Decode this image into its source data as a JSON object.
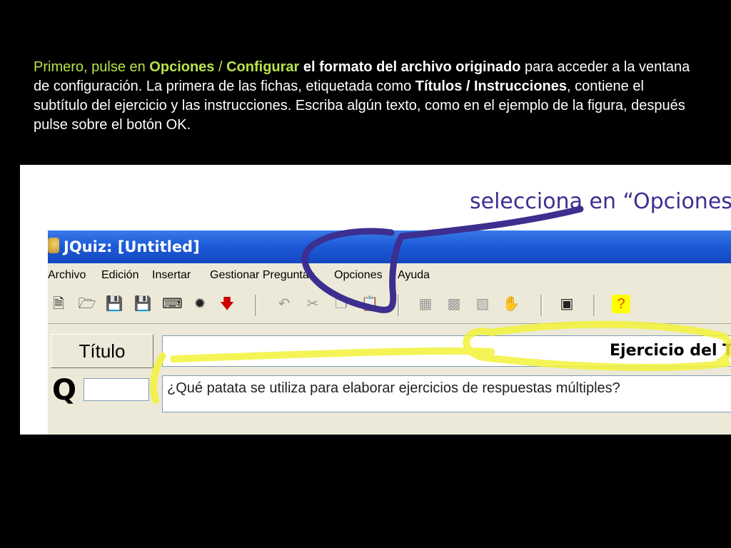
{
  "instructions": {
    "p1": "Primero, pulse en ",
    "opciones": "Opciones",
    "slash": " / ",
    "configurar": "Configurar",
    "bold1": " el formato del archivo originado",
    "p2": " para acceder a la ventana de configuración. La primera de las fichas, etiquetada como ",
    "titulos": "Títulos / Instrucciones",
    "p3": ", contiene el subtítulo del ejercicio y las instrucciones. Escriba algún texto, como en el ejemplo de la figura, después pulse sobre el botón OK."
  },
  "annotation": {
    "text": "selecciona en “Opciones"
  },
  "window": {
    "title": "JQuiz: [Untitled]",
    "menu": [
      "Archivo",
      "Edición",
      "Insertar",
      "Gestionar Preguntas",
      "Opciones",
      "Ayuda"
    ],
    "toolbar_icons": [
      "new-file-icon",
      "open-folder-icon",
      "save-icon",
      "save-as-icon",
      "eraser-icon",
      "web-icon",
      "down-arrow-icon",
      "undo-icon",
      "cut-icon",
      "copy-icon",
      "paste-icon",
      "image-icon",
      "folder-image-icon",
      "link-icon",
      "hand-icon",
      "config-icon",
      "help-icon"
    ],
    "titulo_label": "Título",
    "titulo_value": "Ejercicio del Tutorial",
    "question_number": "Q 1",
    "question_text": "¿Qué patata se utiliza para elaborar ejercicios de respuestas múltiples?"
  },
  "colors": {
    "accent_green": "#b7e34a",
    "annotation_purple": "#3c2f8f",
    "highlight_yellow": "#f2f23a",
    "titlebar_blue": "#1d5cd8"
  }
}
